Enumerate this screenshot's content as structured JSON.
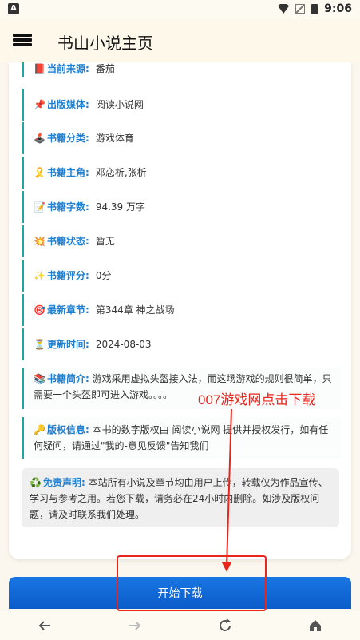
{
  "status": {
    "time": "9:06",
    "left_badge": "A"
  },
  "header": {
    "title": "书山小说主页"
  },
  "info": [
    {
      "emoji": "📕",
      "label": "当前来源:",
      "value": "番茄"
    },
    {
      "emoji": "📌",
      "label": "出版媒体:",
      "value": "阅读小说网"
    },
    {
      "emoji": "🕹️",
      "label": "书籍分类:",
      "value": "游戏体育"
    },
    {
      "emoji": "🎗️",
      "label": "书籍主角:",
      "value": "邓恋析,张析"
    },
    {
      "emoji": "📝",
      "label": "书籍字数:",
      "value": "94.39 万字"
    },
    {
      "emoji": "💥",
      "label": "书籍状态:",
      "value": "暂无"
    },
    {
      "emoji": "✨",
      "label": "书籍评分:",
      "value": "0分"
    },
    {
      "emoji": "🎯",
      "label": "最新章节:",
      "value": "第344章 神之战场"
    },
    {
      "emoji": "⏳",
      "label": "更新时间:",
      "value": "2024-08-03"
    }
  ],
  "intro": {
    "emoji": "📚",
    "label": "书籍简介:",
    "value": "游戏采用虚拟头盔接入法，而这场游戏的规则很简单，只需要一个头盔即可进入游戏。。。。"
  },
  "copyright": {
    "emoji": "🔑",
    "label": "版权信息:",
    "value": "本书的数字版权由 阅读小说网 提供并授权发行，如有任何疑问，请通过\"我的-意见反馈\"告知我们"
  },
  "disclaimer": {
    "emoji": "♻️",
    "label": "免责声明:",
    "value": "本站所有小说及章节均由用户上传，转载仅为作品宣传、学习与参考之用。若您下载，请务必在24小时内删除。如涉及版权问题，请及时联系我们处理。"
  },
  "overlay": {
    "text": "007游戏网点击下载"
  },
  "download_button": {
    "label": "开始下载"
  },
  "colors": {
    "accent": "#21a5a0",
    "label_blue": "#1f7fd0",
    "button_blue": "#1976e3",
    "annotation_red": "#e8261c"
  }
}
